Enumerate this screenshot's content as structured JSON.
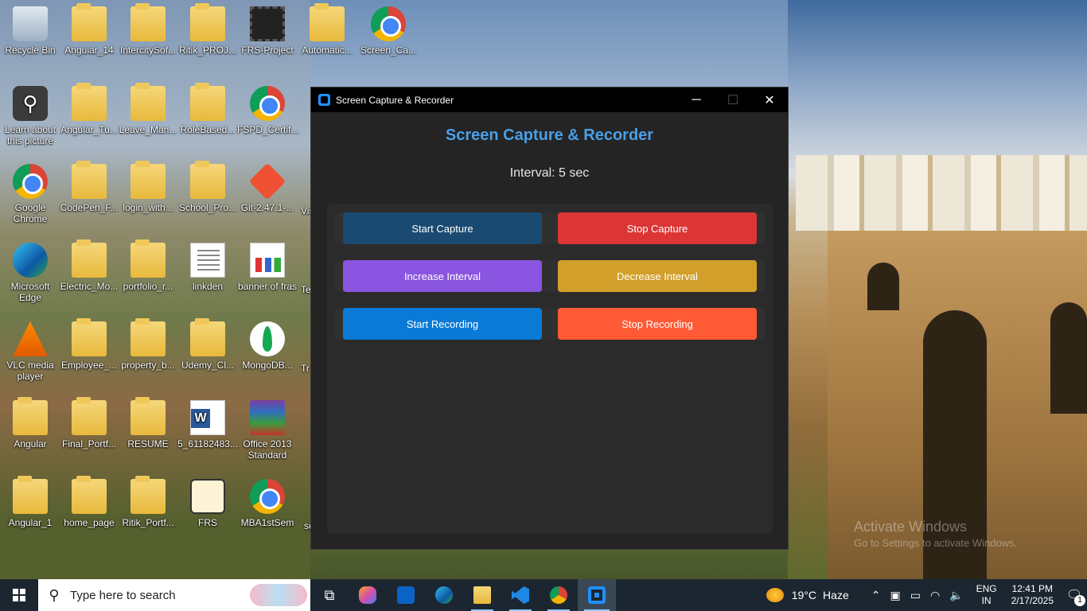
{
  "desktop": {
    "icons": [
      {
        "label": "Recycle Bin",
        "icon": "recycle-bin-icon"
      },
      {
        "label": "Angular_14",
        "icon": "folder-icon"
      },
      {
        "label": "IntercitySof...",
        "icon": "folder-icon"
      },
      {
        "label": "Ritik_PROJ...",
        "icon": "folder-icon"
      },
      {
        "label": "FRS-Project",
        "icon": "video-icon"
      },
      {
        "label": "Automatic...",
        "icon": "folder-icon"
      },
      {
        "label": "Screen_Ca...",
        "icon": "chrome-file-icon"
      },
      {
        "label": "Learn about this picture",
        "icon": "learn-picture-icon"
      },
      {
        "label": "Angular_Tu...",
        "icon": "folder-icon"
      },
      {
        "label": "Leave_Man...",
        "icon": "folder-icon"
      },
      {
        "label": "RoleBased...",
        "icon": "folder-icon"
      },
      {
        "label": "FSPD_Certif...",
        "icon": "chrome-file-icon"
      },
      {
        "label": "Google Chrome",
        "icon": "chrome-icon"
      },
      {
        "label": "CodePen_F...",
        "icon": "folder-icon"
      },
      {
        "label": "login_with...",
        "icon": "folder-icon"
      },
      {
        "label": "School_Pro...",
        "icon": "folder-icon"
      },
      {
        "label": "Git-2.47.1-...",
        "icon": "git-icon"
      },
      {
        "label": "Vis",
        "icon": "vscode-icon"
      },
      {
        "label": "Microsoft Edge",
        "icon": "edge-icon"
      },
      {
        "label": "Electric_Mo...",
        "icon": "folder-icon"
      },
      {
        "label": "portfolio_r...",
        "icon": "folder-icon"
      },
      {
        "label": "linkden",
        "icon": "text-file-icon"
      },
      {
        "label": "banner of fras",
        "icon": "image-file-icon"
      },
      {
        "label": "Te",
        "icon": "file-icon"
      },
      {
        "label": "VLC media player",
        "icon": "vlc-icon"
      },
      {
        "label": "Employee_...",
        "icon": "folder-icon"
      },
      {
        "label": "property_b...",
        "icon": "folder-icon"
      },
      {
        "label": "Udemy_Cl...",
        "icon": "folder-icon"
      },
      {
        "label": "MongoDB...",
        "icon": "mongodb-icon"
      },
      {
        "label": "Tr",
        "icon": "file-icon"
      },
      {
        "label": "Angular",
        "icon": "folder-icon"
      },
      {
        "label": "Final_Portf...",
        "icon": "folder-icon"
      },
      {
        "label": "RESUME",
        "icon": "folder-icon"
      },
      {
        "label": "5_61182483...",
        "icon": "word-icon"
      },
      {
        "label": "Office 2013 Standard",
        "icon": "winrar-icon"
      },
      {
        "label": "Angular_1",
        "icon": "folder-icon"
      },
      {
        "label": "home_page",
        "icon": "folder-icon"
      },
      {
        "label": "Ritik_Portf...",
        "icon": "folder-icon"
      },
      {
        "label": "FRS",
        "icon": "face-scan-icon"
      },
      {
        "label": "MBA1stSem",
        "icon": "chrome-file-icon"
      },
      {
        "label": "sc",
        "icon": "file-icon"
      }
    ],
    "watermark_title": "Activate Windows",
    "watermark_sub": "Go to Settings to activate Windows."
  },
  "window": {
    "title": "Screen Capture & Recorder",
    "controls": {
      "minimize": "─",
      "maximize": "☐",
      "close": "✕"
    }
  },
  "app": {
    "heading": "Screen Capture & Recorder",
    "interval": "Interval: 5 sec",
    "buttons": {
      "start_capture": "Start Capture",
      "stop_capture": "Stop Capture",
      "increase_interval": "Increase Interval",
      "decrease_interval": "Decrease Interval",
      "start_recording": "Start Recording",
      "stop_recording": "Stop Recording"
    },
    "colors": {
      "heading": "#4a9fe8",
      "start_capture": "#1a4a72",
      "stop_capture": "#dc3535",
      "increase_interval": "#8a55e0",
      "decrease_interval": "#d2a02a",
      "start_recording": "#0a7ad6",
      "stop_recording": "#ff5a36"
    }
  },
  "taskbar": {
    "search_placeholder": "Type here to search",
    "weather_temp": "19°C",
    "weather_desc": "Haze",
    "lang_line1": "ENG",
    "lang_line2": "IN",
    "time": "12:41 PM",
    "date": "2/17/2025",
    "notification_count": "1"
  }
}
